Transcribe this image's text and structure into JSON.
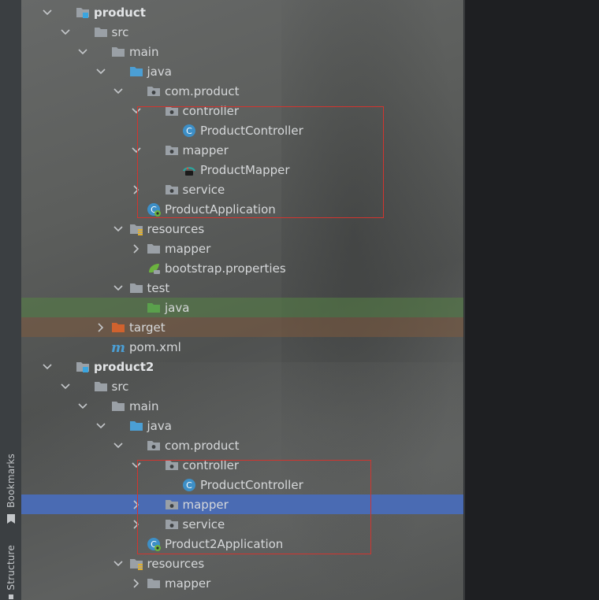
{
  "tool_window": {
    "bookmarks_label": "Bookmarks",
    "structure_label": "Structure"
  },
  "project_tree": {
    "items": [
      {
        "label": "product",
        "icon": "module-folder-icon",
        "expanded": true,
        "bold": true
      },
      {
        "label": "src",
        "icon": "folder-icon",
        "expanded": true
      },
      {
        "label": "main",
        "icon": "folder-icon",
        "expanded": true
      },
      {
        "label": "java",
        "icon": "source-root-folder-icon",
        "expanded": true
      },
      {
        "label": "com.product",
        "icon": "package-icon",
        "expanded": true
      },
      {
        "label": "controller",
        "icon": "package-icon",
        "expanded": true
      },
      {
        "label": "ProductController",
        "icon": "class-icon"
      },
      {
        "label": "mapper",
        "icon": "package-icon",
        "expanded": true
      },
      {
        "label": "ProductMapper",
        "icon": "mybatis-mapper-icon"
      },
      {
        "label": "service",
        "icon": "package-icon",
        "expanded": false
      },
      {
        "label": "ProductApplication",
        "icon": "spring-boot-class-icon"
      },
      {
        "label": "resources",
        "icon": "resources-folder-icon",
        "expanded": true
      },
      {
        "label": "mapper",
        "icon": "folder-icon",
        "expanded": false
      },
      {
        "label": "bootstrap.properties",
        "icon": "spring-properties-icon"
      },
      {
        "label": "test",
        "icon": "folder-icon",
        "expanded": true
      },
      {
        "label": "java",
        "icon": "test-root-folder-icon",
        "highlight": "green"
      },
      {
        "label": "target",
        "icon": "excluded-folder-icon",
        "expanded": false,
        "highlight": "orange"
      },
      {
        "label": "pom.xml",
        "icon": "maven-icon"
      },
      {
        "label": "product2",
        "icon": "module-folder-icon",
        "expanded": true,
        "bold": true
      },
      {
        "label": "src",
        "icon": "folder-icon",
        "expanded": true
      },
      {
        "label": "main",
        "icon": "folder-icon",
        "expanded": true
      },
      {
        "label": "java",
        "icon": "source-root-folder-icon",
        "expanded": true
      },
      {
        "label": "com.product",
        "icon": "package-icon",
        "expanded": true
      },
      {
        "label": "controller",
        "icon": "package-icon",
        "expanded": true
      },
      {
        "label": "ProductController",
        "icon": "class-icon"
      },
      {
        "label": "mapper",
        "icon": "package-icon",
        "expanded": false,
        "selected": true
      },
      {
        "label": "service",
        "icon": "package-icon",
        "expanded": false
      },
      {
        "label": "Product2Application",
        "icon": "spring-boot-class-icon"
      },
      {
        "label": "resources",
        "icon": "resources-folder-icon",
        "expanded": true
      },
      {
        "label": "mapper",
        "icon": "folder-icon",
        "expanded": false
      }
    ]
  },
  "colors": {
    "selection": "#4a6bb3",
    "annotation_box": "#d2352f",
    "folder": "#9aa0a6",
    "source_root": "#4b9fd5",
    "test_root": "#5aa04c",
    "excluded": "#d0622e"
  }
}
